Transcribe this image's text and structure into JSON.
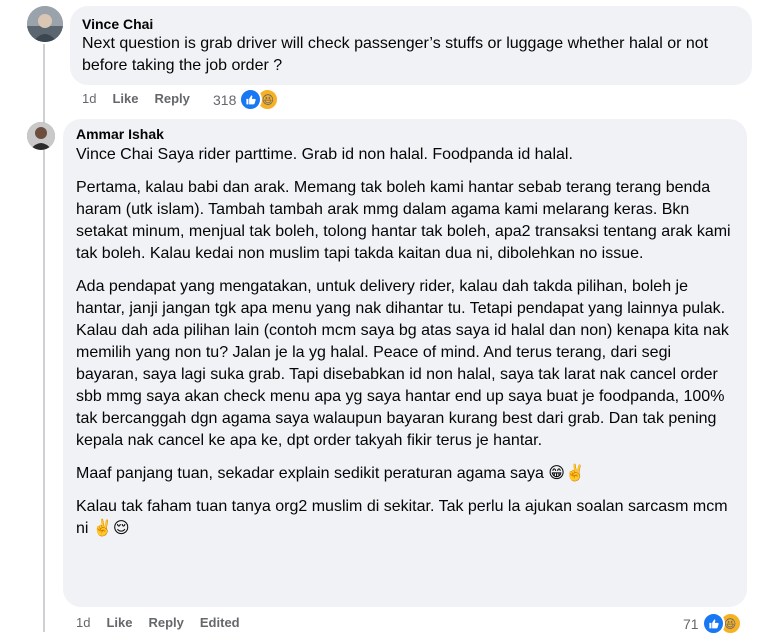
{
  "comment1": {
    "author": "Vince Chai",
    "text": "Next question is grab driver will check passenger’s stuffs or luggage whether halal or not before taking the job order ?",
    "age": "1d",
    "like_label": "Like",
    "reply_label": "Reply",
    "reaction_count": "318",
    "reactions": [
      "like-icon",
      "haha-icon"
    ]
  },
  "comment2": {
    "author": "Ammar Ishak",
    "mention": "Vince Chai",
    "first_line": "Saya rider parttime. Grab id non halal. Foodpanda id halal.",
    "paragraphs": [
      "Pertama, kalau babi dan arak. Memang tak boleh kami hantar sebab terang terang benda haram (utk islam). Tambah tambah arak mmg dalam agama kami melarang keras. Bkn setakat minum, menjual tak boleh, tolong hantar tak boleh, apa2 transaksi tentang arak kami tak boleh. Kalau kedai non muslim tapi takda kaitan dua ni, dibolehkan no issue.",
      "Ada pendapat yang mengatakan, untuk delivery rider, kalau dah takda pilihan, boleh je hantar, janji jangan tgk apa menu yang nak dihantar tu. Tetapi pendapat yang lainnya pulak. Kalau dah ada pilihan lain (contoh mcm saya bg atas saya id halal dan non) kenapa kita nak memilih yang non tu? Jalan je la yg halal. Peace of mind. And terus terang, dari segi bayaran, saya lagi suka grab. Tapi disebabkan id non halal, saya tak larat nak cancel order sbb mmg saya akan check menu apa yg saya hantar end up saya buat je foodpanda, 100% tak bercanggah dgn agama saya walaupun bayaran kurang best dari grab. Dan tak pening kepala nak cancel ke apa ke, dpt order takyah fikir terus je hantar.",
      "Maaf panjang tuan, sekadar explain sedikit peraturan agama saya 😁✌️",
      "Kalau tak faham tuan tanya org2 muslim di sekitar. Tak perlu la ajukan soalan sarcasm mcm ni ✌️😌"
    ],
    "age": "1d",
    "like_label": "Like",
    "reply_label": "Reply",
    "edited_label": "Edited",
    "reaction_count": "71",
    "reactions": [
      "like-icon",
      "haha-icon"
    ]
  }
}
